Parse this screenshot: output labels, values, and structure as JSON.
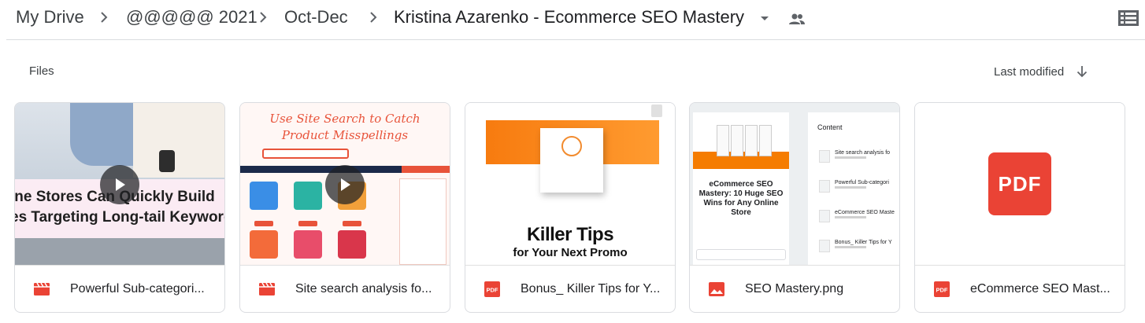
{
  "breadcrumb": {
    "items": [
      "My Drive",
      "@@@@@ 2021",
      "Oct-Dec",
      "Kristina Azarenko - Ecommerce SEO Mastery"
    ]
  },
  "icons": {
    "separator": "chevron-right-icon",
    "dropdown": "arrow-drop-down-icon",
    "shared": "people-icon",
    "view": "list-view-icon",
    "sort_direction": "arrow-down-icon"
  },
  "files_section": {
    "label": "Files",
    "sort_label": "Last modified"
  },
  "colors": {
    "video_icon": "#ea4335",
    "pdf_icon": "#ea4335",
    "image_icon": "#ea4335",
    "border": "#dadce0"
  },
  "thumbnails": {
    "card1_line1": "ine Stores Can Quickly Build",
    "card1_line2": "es Targeting Long-tail Keyword",
    "card2_title": "Use Site Search to Catch Product Misspellings",
    "card3_big": "Killer Tips",
    "card3_sub": "for Your Next Promo",
    "card4_title": "eCommerce SEO Mastery: 10 Huge SEO Wins for Any Online Store",
    "card4_content": "Content",
    "card4_rows": [
      "Site search analysis fo",
      "Powerful Sub-categori",
      "eCommerce SEO Maste",
      "Bonus_ Killer Tips for Y"
    ],
    "card5_badge": "PDF"
  },
  "files": [
    {
      "name": "Powerful Sub-categori...",
      "type": "video",
      "icon": "video-file-icon"
    },
    {
      "name": "Site search analysis fo...",
      "type": "video",
      "icon": "video-file-icon"
    },
    {
      "name": "Bonus_ Killer Tips for Y...",
      "type": "pdf",
      "icon": "pdf-file-icon"
    },
    {
      "name": "SEO Mastery.png",
      "type": "image",
      "icon": "image-file-icon"
    },
    {
      "name": "eCommerce SEO Mast...",
      "type": "pdf",
      "icon": "pdf-file-icon"
    }
  ]
}
